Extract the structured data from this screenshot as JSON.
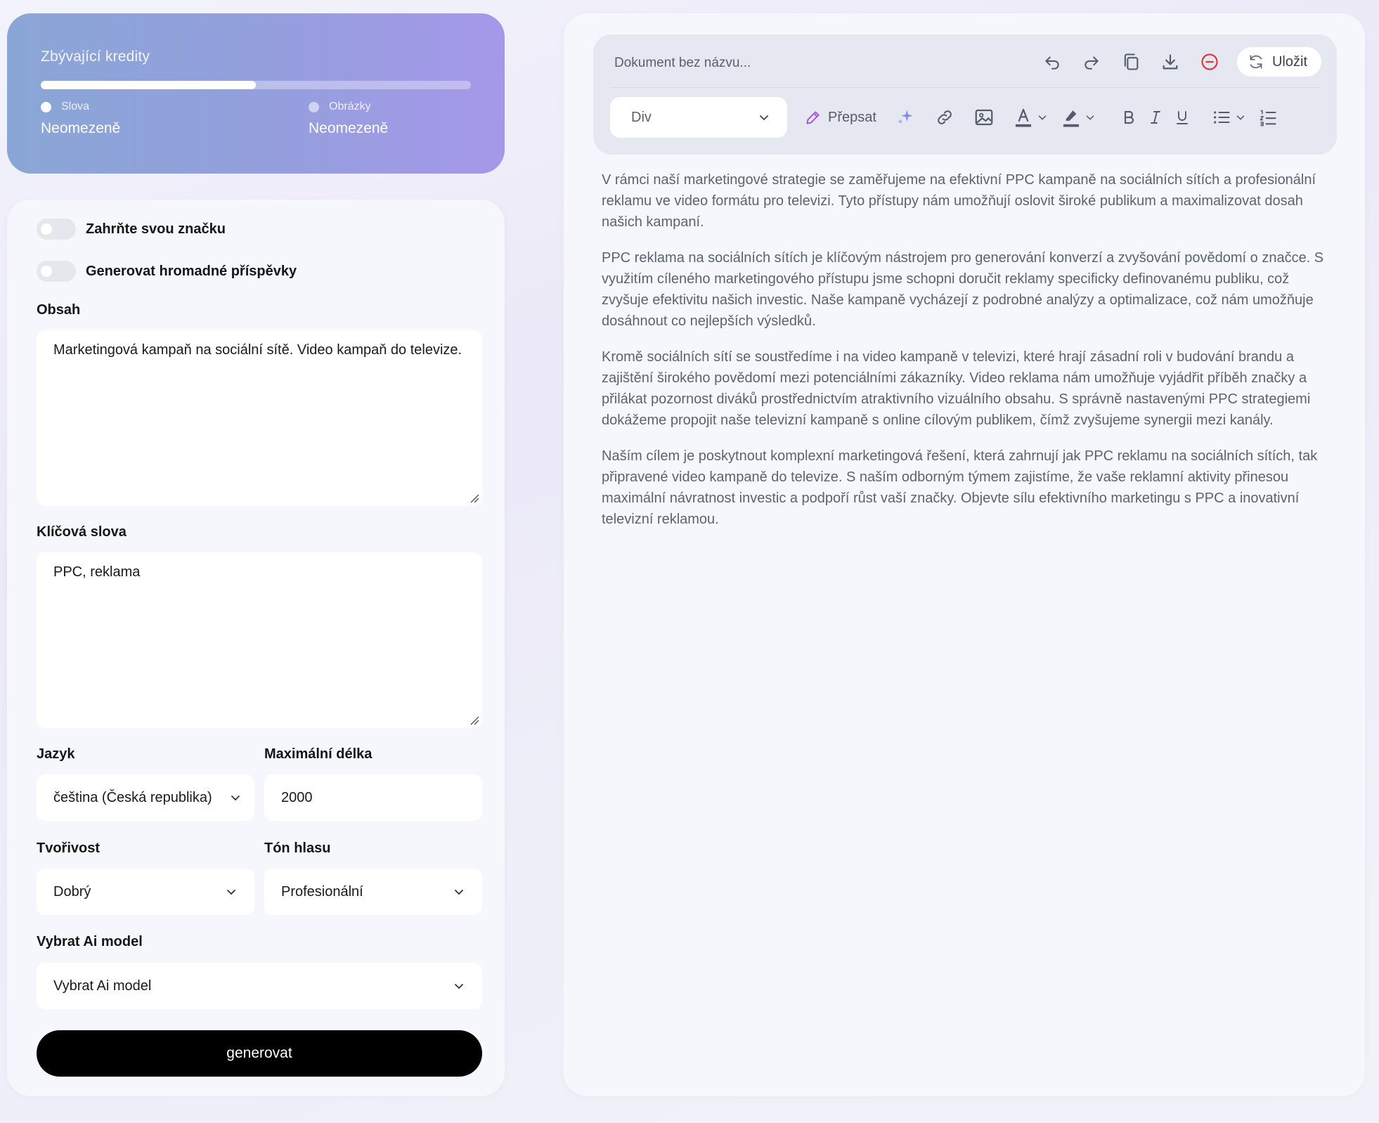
{
  "credits": {
    "title": "Zbývající kredity",
    "progress": 0.5,
    "words_label": "Slova",
    "words_value": "Neomezeně",
    "images_label": "Obrázky",
    "images_value": "Neomezeně"
  },
  "form": {
    "brand_toggle_label": "Zahrňte svou značku",
    "bulk_toggle_label": "Generovat hromadné příspěvky",
    "content_label": "Obsah",
    "content_value": "Marketingová kampaň na sociální sítě. Video kampaň do televize.",
    "keywords_label": "Klíčová slova",
    "keywords_value": "PPC, reklama",
    "language_label": "Jazyk",
    "language_value": "čeština (Česká republika)",
    "max_length_label": "Maximální délka",
    "max_length_value": "2000",
    "creativity_label": "Tvořivost",
    "creativity_value": "Dobrý",
    "tone_label": "Tón hlasu",
    "tone_value": "Profesionální",
    "ai_model_label": "Vybrat Ai model",
    "ai_model_value": "Vybrat Ai model",
    "generate_label": "generovat"
  },
  "editor": {
    "doc_title_placeholder": "Dokument bez názvu...",
    "save_label": "Uložit",
    "block_type": "Div",
    "rewrite_label": "Přepsat",
    "paragraphs": [
      "V rámci naší marketingové strategie se zaměřujeme na efektivní PPC kampaně na sociálních sítích a profesionální reklamu ve video formátu pro televizi. Tyto přístupy nám umožňují oslovit široké publikum a maximalizovat dosah našich kampaní.",
      "PPC reklama na sociálních sítích je klíčovým nástrojem pro generování konverzí a zvyšování povědomí o značce. S využitím cíleného marketingového přístupu jsme schopni doručit reklamy specificky definovanému publiku, což zvyšuje efektivitu našich investic. Naše kampaně vycházejí z podrobné analýzy a optimalizace, což nám umožňuje dosáhnout co nejlepších výsledků.",
      "Kromě sociálních sítí se soustředíme i na video kampaně v televizi, které hrají zásadní roli v budování brandu a zajištění širokého povědomí mezi potenciálními zákazníky. Video reklama nám umožňuje vyjádřit příběh značky a přilákat pozornost diváků prostřednictvím atraktivního vizuálního obsahu. S správně nastavenými PPC strategiemi dokážeme propojit naše televizní kampaně s online cílovým publikem, čímž zvyšujeme synergii mezi kanály.",
      "Naším cílem je poskytnout komplexní marketingová řešení, která zahrnují jak PPC reklamu na sociálních sítích, tak připravené video kampaně do televize. S naším odborným týmem zajistíme, že vaše reklamní aktivity přinesou maximální návratnost investic a podpoří růst vaší značky. Objevte sílu efektivního marketingu s PPC a inovativní televizní reklamou."
    ]
  },
  "colors": {
    "accent_purple": "#a598e9",
    "accent_blue": "#8aa6d6",
    "danger_red": "#e0383b",
    "sparkle_blue": "#7d8cf0"
  }
}
